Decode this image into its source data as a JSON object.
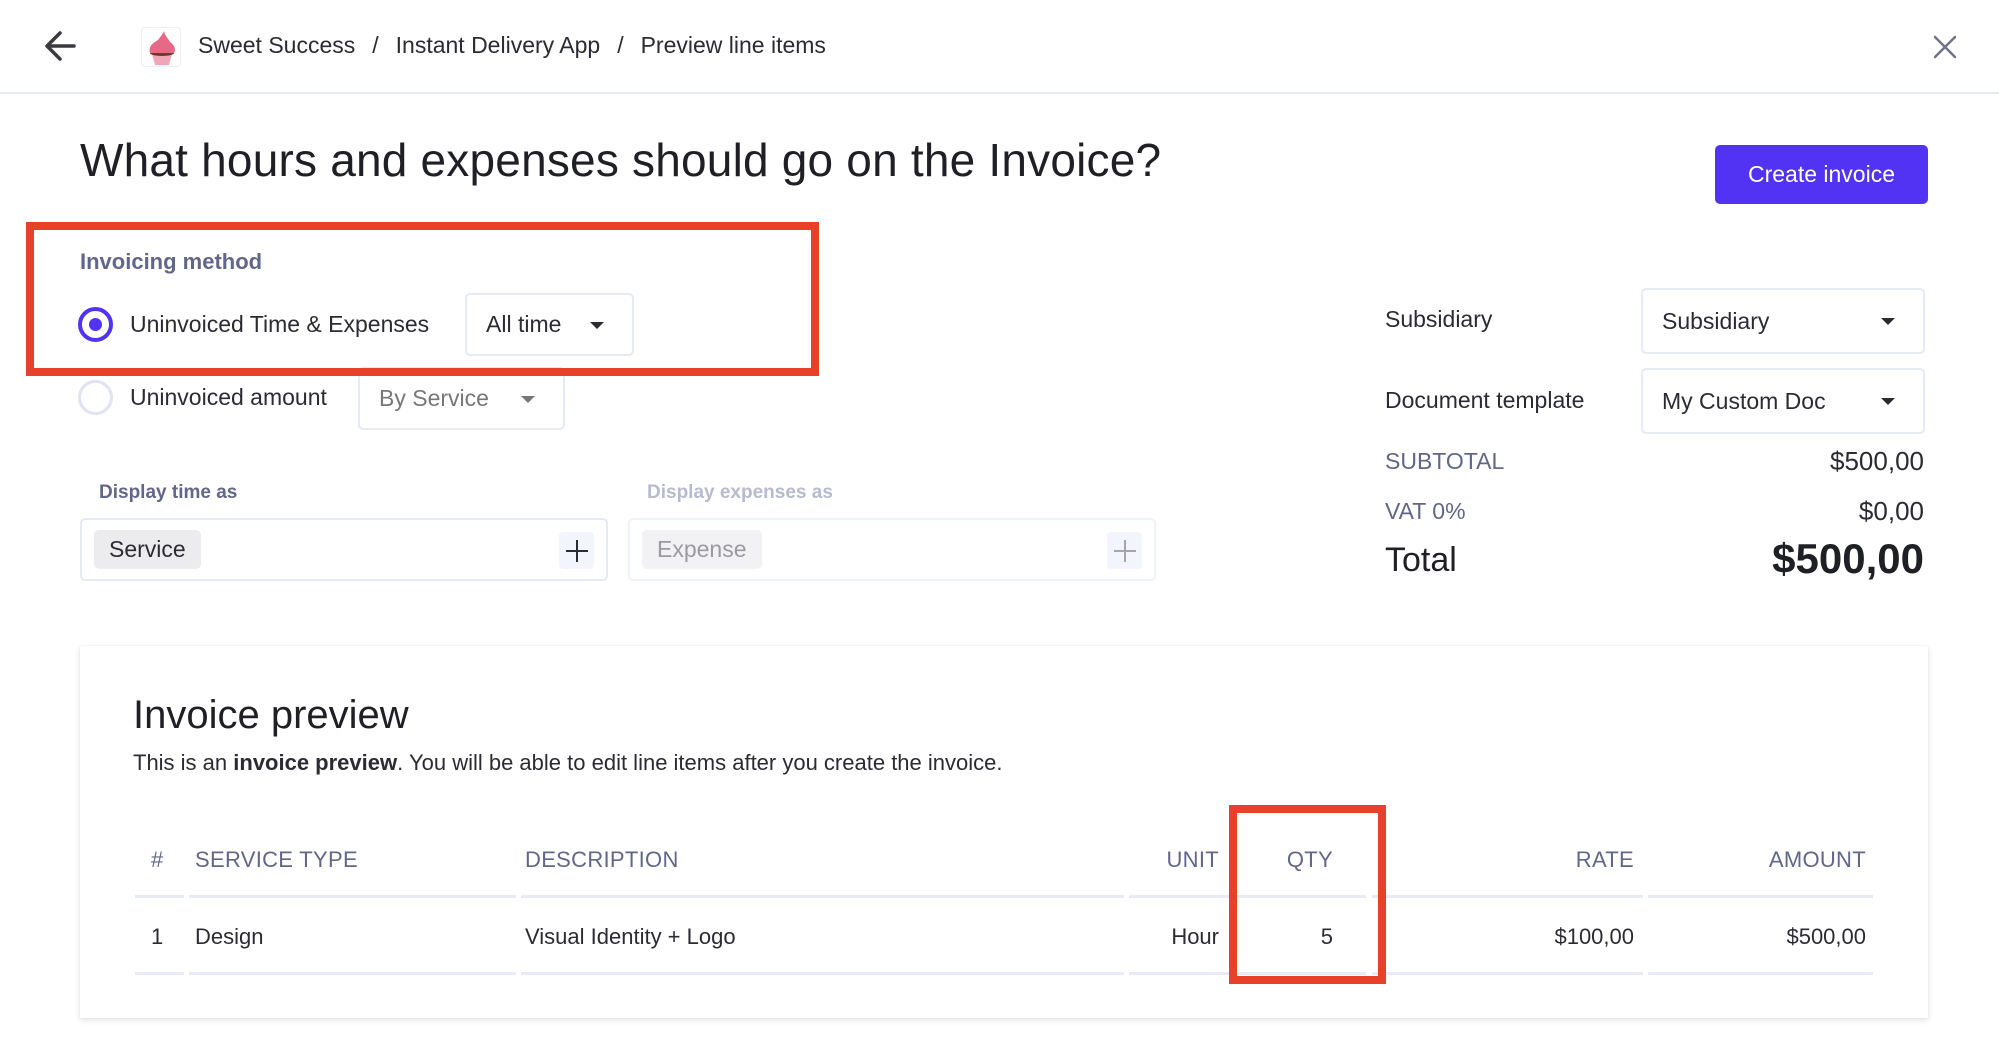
{
  "header": {
    "back_icon": "arrow-left-icon",
    "logo_icon": "cupcake-logo",
    "breadcrumb": [
      "Sweet Success",
      "Instant Delivery App",
      "Preview line items"
    ],
    "separator": "/",
    "close_icon": "close-x-icon"
  },
  "page": {
    "title": "What hours and expenses should go on the Invoice?",
    "create_button": "Create invoice",
    "accent_color": "#5233f4",
    "annotation_color": "#e8412a"
  },
  "invoicing_method": {
    "label": "Invoicing method",
    "options": [
      {
        "label": "Uninvoiced Time & Expenses",
        "selected": true,
        "dropdown": "All time"
      },
      {
        "label": "Uninvoiced amount",
        "selected": false,
        "dropdown": "By Service"
      }
    ]
  },
  "display": {
    "time_label": "Display time as",
    "time_tag": "Service",
    "expenses_label": "Display expenses as",
    "expenses_tag": "Expense"
  },
  "side": {
    "subsidiary_label": "Subsidiary",
    "subsidiary_value": "Subsidiary",
    "template_label": "Document template",
    "template_value": "My Custom Doc",
    "subtotal_label": "SUBTOTAL",
    "subtotal_value": "$500,00",
    "vat_label": "VAT 0%",
    "vat_value": "$0,00",
    "total_label": "Total",
    "total_value": "$500,00"
  },
  "preview": {
    "title": "Invoice preview",
    "subtitle_prefix": "This is an ",
    "subtitle_bold": "invoice preview",
    "subtitle_suffix": ". You will be able to edit line items after you create the invoice.",
    "columns": [
      "#",
      "SERVICE TYPE",
      "DESCRIPTION",
      "UNIT",
      "QTY",
      "RATE",
      "AMOUNT"
    ],
    "rows": [
      {
        "num": "1",
        "type": "Design",
        "desc": "Visual Identity + Logo",
        "unit": "Hour",
        "qty": "5",
        "rate": "$100,00",
        "amount": "$500,00"
      }
    ]
  }
}
